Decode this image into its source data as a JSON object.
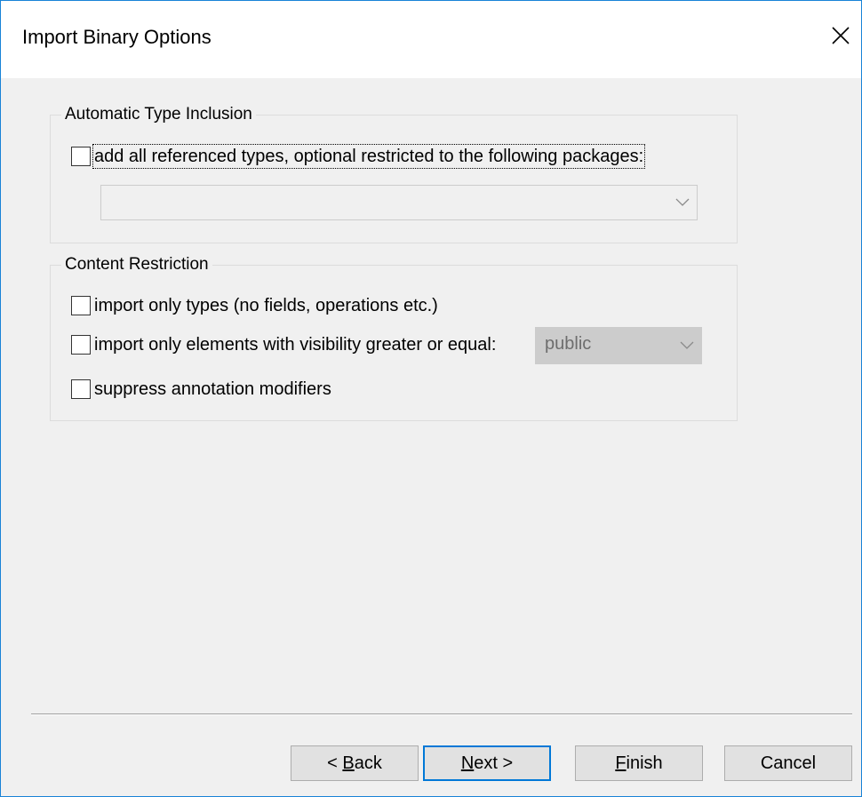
{
  "window": {
    "title": "Import Binary Options",
    "close_icon": "close-icon"
  },
  "automatic_type_inclusion": {
    "legend": "Automatic Type Inclusion",
    "add_referenced_types_label": "add all referenced types, optional restricted to the following packages:",
    "add_referenced_types_checked": false,
    "packages_value": ""
  },
  "content_restriction": {
    "legend": "Content Restriction",
    "import_only_types_label": "import only types (no fields, operations etc.)",
    "import_only_types_checked": false,
    "visibility_label": "import only elements with visibility greater or equal:",
    "visibility_checked": false,
    "visibility_value": "public",
    "suppress_annotation_label": "suppress annotation modifiers",
    "suppress_annotation_checked": false
  },
  "buttons": {
    "back_prefix": "< ",
    "back_mnemonic": "B",
    "back_rest": "ack",
    "next_mnemonic": "N",
    "next_rest": "ext >",
    "finish_mnemonic": "F",
    "finish_rest": "inish",
    "cancel_label": "Cancel"
  },
  "colors": {
    "accent": "#0078d7",
    "window_border": "#1883d7",
    "dialog_bg": "#f0f0f0",
    "disabled_text": "#6d6d6d"
  }
}
